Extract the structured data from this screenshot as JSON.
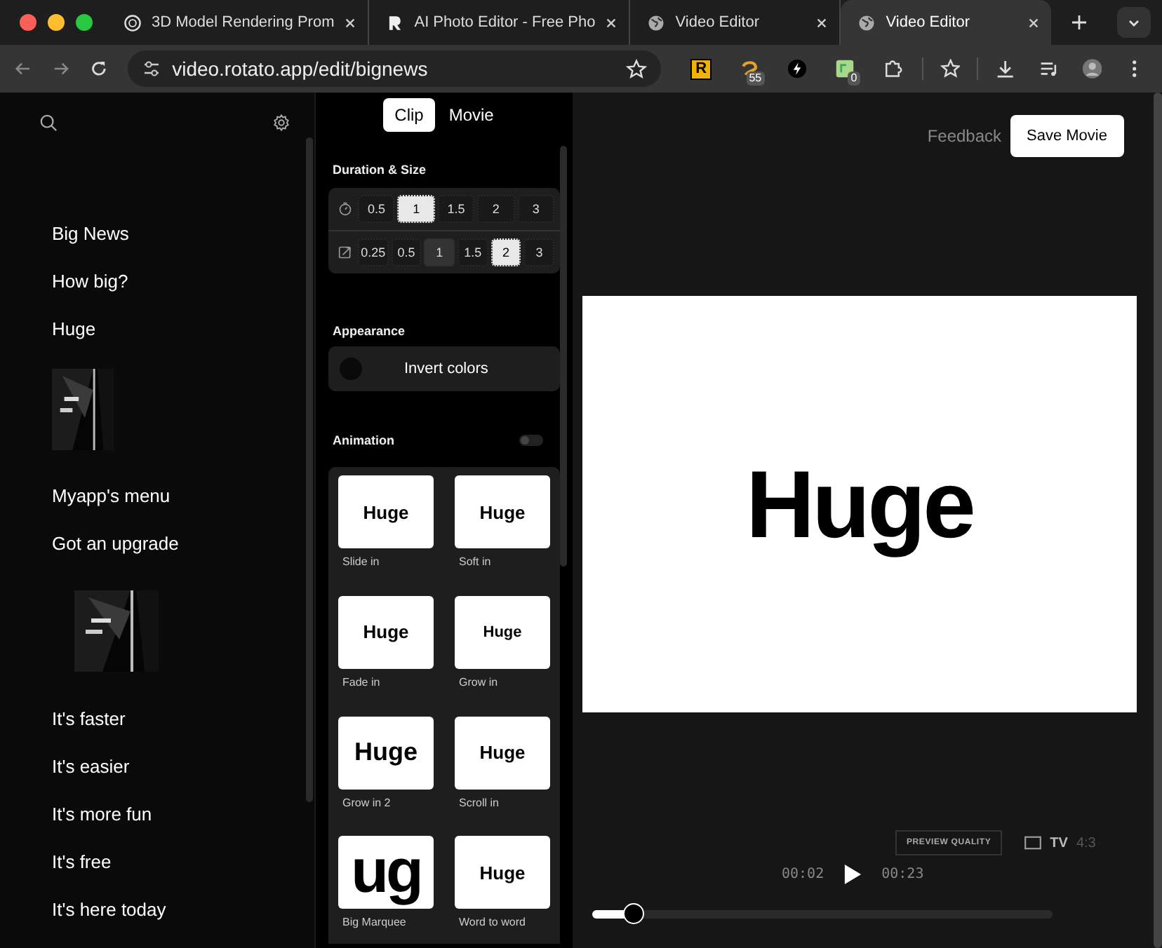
{
  "browser": {
    "tabs": [
      {
        "title": "3D Model Rendering Prom",
        "kind": "aperture",
        "selected": false
      },
      {
        "title": "AI Photo Editor - Free Pho",
        "kind": "r-logo",
        "selected": false
      },
      {
        "title": "Video Editor",
        "kind": "globe",
        "selected": false
      },
      {
        "title": "Video Editor",
        "kind": "globe",
        "selected": true
      }
    ],
    "address": "video.rotato.app/edit/bignews",
    "extensions": [
      {
        "kind": "letter",
        "label": "R"
      },
      {
        "kind": "swirl",
        "badge": "55"
      },
      {
        "kind": "bolt"
      },
      {
        "kind": "card",
        "badge": "0"
      },
      {
        "kind": "puzzle"
      }
    ]
  },
  "sidebar": {
    "items": [
      {
        "kind": "text",
        "label": "Big News"
      },
      {
        "kind": "text",
        "label": "How big?"
      },
      {
        "kind": "text",
        "label": "Huge"
      },
      {
        "kind": "picture"
      },
      {
        "kind": "text",
        "label": "Myapp's menu"
      },
      {
        "kind": "text",
        "label": "Got an upgrade"
      },
      {
        "kind": "picture"
      },
      {
        "kind": "text",
        "label": "It's faster"
      },
      {
        "kind": "text",
        "label": "It's easier"
      },
      {
        "kind": "text",
        "label": "It's more fun"
      },
      {
        "kind": "text",
        "label": "It's free"
      },
      {
        "kind": "text",
        "label": "It's here today"
      }
    ]
  },
  "panel": {
    "tabs": [
      {
        "label": "Clip",
        "selected": true
      },
      {
        "label": "Movie",
        "selected": false
      }
    ],
    "duration_size": {
      "title": "Duration & Size",
      "rows": [
        {
          "kind": "timer",
          "options": [
            {
              "label": "0.5",
              "selected": false,
              "hovered": false
            },
            {
              "label": "1",
              "selected": true,
              "hovered": false
            },
            {
              "label": "1.5",
              "selected": false,
              "hovered": false
            },
            {
              "label": "2",
              "selected": false,
              "hovered": false
            },
            {
              "label": "3",
              "selected": false,
              "hovered": false
            }
          ]
        },
        {
          "kind": "resize",
          "options": [
            {
              "label": "0.25",
              "selected": false,
              "hovered": false
            },
            {
              "label": "0.5",
              "selected": false,
              "hovered": false
            },
            {
              "label": "1",
              "selected": false,
              "hovered": true
            },
            {
              "label": "1.5",
              "selected": false,
              "hovered": false
            },
            {
              "label": "2",
              "selected": true,
              "hovered": false
            },
            {
              "label": "3",
              "selected": false,
              "hovered": false
            }
          ]
        }
      ]
    },
    "appearance": {
      "title": "Appearance",
      "invert_label": "Invert colors",
      "invert_on": false
    },
    "animation": {
      "title": "Animation",
      "on": false,
      "presets": [
        {
          "preview": "Huge",
          "label": "Slide in"
        },
        {
          "preview": "Huge",
          "label": "Soft in"
        },
        {
          "preview": "Huge",
          "label": "Fade in"
        },
        {
          "preview": "Huge",
          "label": "Grow in"
        },
        {
          "preview": "Huge",
          "label": "Grow in 2"
        },
        {
          "preview": "Huge",
          "label": "Scroll in"
        },
        {
          "preview": "ug",
          "label": "Big Marquee"
        },
        {
          "preview": "Huge",
          "label": "Word to word"
        }
      ]
    }
  },
  "preview": {
    "feedback": "Feedback",
    "save": "Save Movie",
    "canvas_text": "Huge",
    "quality": "PREVIEW QUALITY",
    "device": "TV",
    "ratio": "4:3",
    "current_time": "00:02",
    "total_time": "00:23",
    "level": 0.09
  }
}
